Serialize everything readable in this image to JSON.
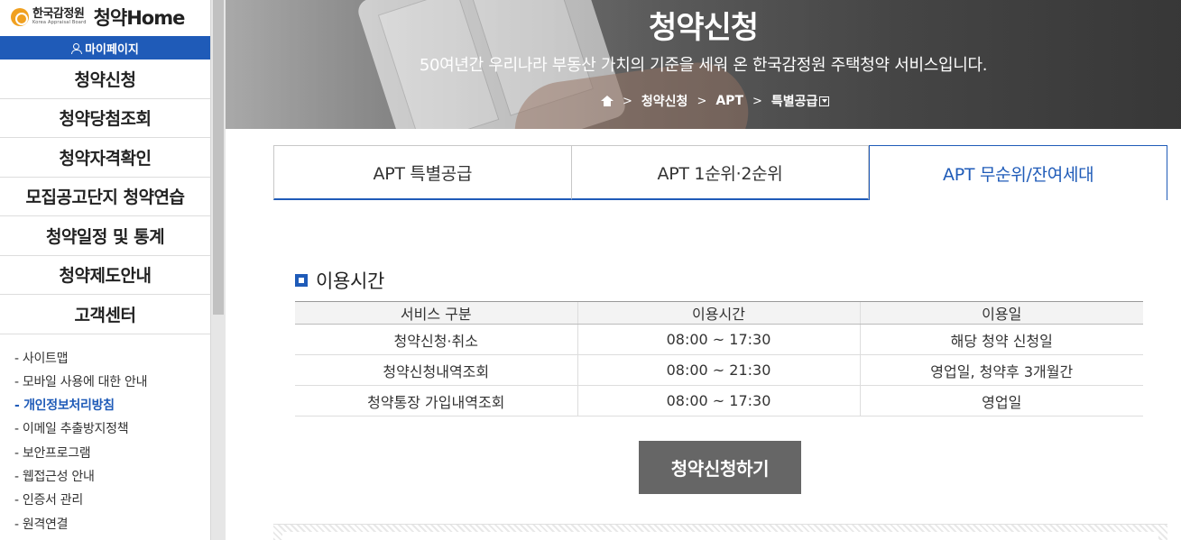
{
  "logo": {
    "org_ko": "한국감정원",
    "org_en": "Korea Appraisal Board",
    "brand": "청약Home"
  },
  "sidebar": {
    "mypage_label": "마이페이지",
    "menu": [
      {
        "label": "청약신청"
      },
      {
        "label": "청약당첨조회"
      },
      {
        "label": "청약자격확인"
      },
      {
        "label": "모집공고단지 청약연습"
      },
      {
        "label": "청약일정 및 통계"
      },
      {
        "label": "청약제도안내"
      },
      {
        "label": "고객센터"
      }
    ],
    "sub_links": [
      {
        "label": "- 사이트맵"
      },
      {
        "label": "- 모바일 사용에 대한 안내"
      },
      {
        "label": "- 개인정보처리방침"
      },
      {
        "label": "- 이메일 추출방지정책"
      },
      {
        "label": "- 보안프로그램"
      },
      {
        "label": "- 웹접근성 안내"
      },
      {
        "label": "- 인증서 관리"
      },
      {
        "label": "- 원격연결"
      }
    ]
  },
  "hero": {
    "title": "청약신청",
    "subtitle": "50여년간 우리나라 부동산 가치의 기준을 세워 온 한국감정원 주택청약 서비스입니다.",
    "breadcrumb": [
      "청약신청",
      "APT",
      "특별공급"
    ]
  },
  "tabs": [
    {
      "label": "APT 특별공급"
    },
    {
      "label": "APT 1순위·2순위"
    },
    {
      "label": "APT 무순위/잔여세대"
    }
  ],
  "usage": {
    "section_title": "이용시간",
    "headers": [
      "서비스 구분",
      "이용시간",
      "이용일"
    ],
    "rows": [
      [
        "청약신청·취소",
        "08:00 ~ 17:30",
        "해당 청약 신청일"
      ],
      [
        "청약신청내역조회",
        "08:00 ~ 21:30",
        "영업일, 청약후 3개월간"
      ],
      [
        "청약통장 가입내역조회",
        "08:00 ~ 17:30",
        "영업일"
      ]
    ]
  },
  "apply_button": "청약신청하기",
  "colors": {
    "accent": "#1f5bb8",
    "button": "#666666"
  }
}
